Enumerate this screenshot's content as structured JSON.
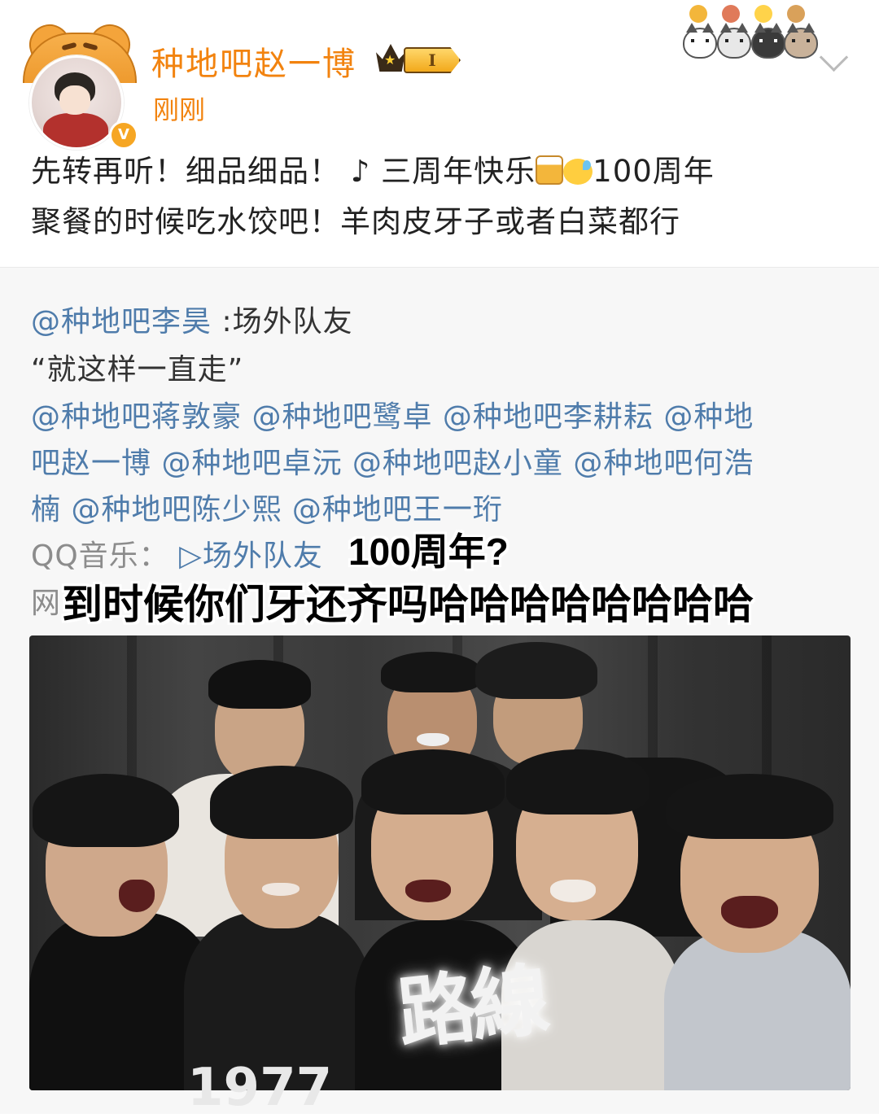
{
  "post": {
    "username": "种地吧赵一博",
    "level_label": "I",
    "timestamp": "刚刚",
    "text_line1_part1": "先转再听！细品细品！",
    "music_note": "♪",
    "text_line1_part2": "三周年快乐",
    "text_line1_part3": "100周年",
    "text_line2": "聚餐的时候吃水饺吧！羊肉皮牙子或者白菜都行",
    "avatar_badge": "V"
  },
  "repost": {
    "author": "@种地吧李昊",
    "author_suffix": ":场外队友",
    "quote": "“就这样一直走”",
    "mentions_line1": "@种地吧蒋敦豪 @种地吧鹭卓 @种地吧李耕耘 @种地",
    "mentions_line2": "吧赵一博 @种地吧卓沅 @种地吧赵小童 @种地吧何浩",
    "mentions_line3": "楠 @种地吧陈少熙 @种地吧王一珩",
    "music_source": "QQ音乐：",
    "music_link": "▷场外队友",
    "line_hidden_prefix": "网"
  },
  "overlay": {
    "caption1": "100周年?",
    "caption2": "到时候你们牙还齐吗哈哈哈哈哈哈哈哈"
  },
  "photo": {
    "watermark": "路線",
    "jersey_text": "1977"
  },
  "icons": {
    "chevron": "chevron-down-icon",
    "crown": "crown-icon",
    "stickers": "cat-stickers-icon"
  }
}
